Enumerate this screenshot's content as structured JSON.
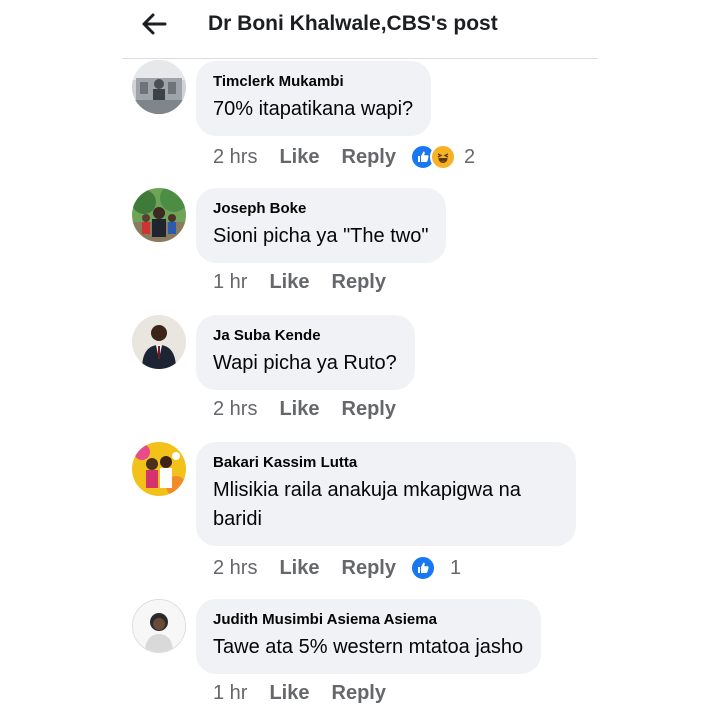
{
  "header": {
    "title": "Dr Boni Khalwale,CBS's post"
  },
  "comments": [
    {
      "author": "Timclerk Mukambi",
      "text": "70% itapatikana wapi?",
      "time": "2 hrs",
      "like": "Like",
      "reply": "Reply",
      "reactions": [
        "like-reaction-icon",
        "haha-reaction-icon"
      ],
      "reaction_count": "2"
    },
    {
      "author": "Joseph Boke",
      "text": "Sioni picha ya \"The two\"",
      "time": "1 hr",
      "like": "Like",
      "reply": "Reply",
      "reactions": [],
      "reaction_count": ""
    },
    {
      "author": "Ja Suba Kende",
      "text": "Wapi picha ya Ruto?",
      "time": "2 hrs",
      "like": "Like",
      "reply": "Reply",
      "reactions": [],
      "reaction_count": ""
    },
    {
      "author": "Bakari Kassim Lutta",
      "text": "Mlisikia raila anakuja mkapigwa na baridi",
      "time": "2 hrs",
      "like": "Like",
      "reply": "Reply",
      "reactions": [
        "like-reaction-icon"
      ],
      "reaction_count": "1"
    },
    {
      "author": "Judith Musimbi Asiema Asiema",
      "text": "Tawe ata 5% western mtatoa jasho",
      "time": "1 hr",
      "like": "Like",
      "reply": "Reply",
      "reactions": [],
      "reaction_count": ""
    }
  ],
  "colors": {
    "bubble": "#f0f2f5",
    "meta": "#65676b",
    "like_blue": "#1877f2",
    "haha_yellow": "#f7b125"
  }
}
